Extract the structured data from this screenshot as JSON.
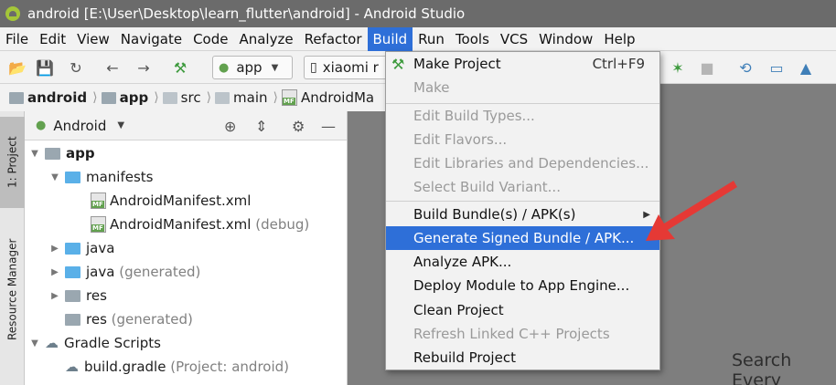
{
  "window": {
    "title": "android [E:\\User\\Desktop\\learn_flutter\\android] - Android Studio"
  },
  "menu": [
    "File",
    "Edit",
    "View",
    "Navigate",
    "Code",
    "Analyze",
    "Refactor",
    "Build",
    "Run",
    "Tools",
    "VCS",
    "Window",
    "Help"
  ],
  "menu_active": "Build",
  "toolbar": {
    "run_config": "app",
    "device": "xiaomi r"
  },
  "breadcrumb": [
    "android",
    "app",
    "src",
    "main",
    "AndroidMa"
  ],
  "sidestrip": {
    "project_tab": "1: Project",
    "resource_tab": "Resource Manager"
  },
  "project_panel": {
    "view_selector": "Android",
    "tree": [
      {
        "label": "app",
        "bold": true
      },
      {
        "label": "manifests"
      },
      {
        "label": "AndroidManifest.xml"
      },
      {
        "label": "AndroidManifest.xml",
        "suffix": "(debug)"
      },
      {
        "label": "java"
      },
      {
        "label": "java",
        "suffix": "(generated)"
      },
      {
        "label": "res"
      },
      {
        "label": "res",
        "suffix": "(generated)"
      },
      {
        "label": "Gradle Scripts"
      },
      {
        "label": "build.gradle",
        "suffix": "(Project: android)"
      }
    ]
  },
  "build_menu": {
    "items": [
      {
        "label": "Make Project",
        "shortcut": "Ctrl+F9",
        "enabled": true
      },
      {
        "label": "Make",
        "enabled": false
      },
      {
        "label": "Edit Build Types...",
        "enabled": false
      },
      {
        "label": "Edit Flavors...",
        "enabled": false
      },
      {
        "label": "Edit Libraries and Dependencies...",
        "enabled": false
      },
      {
        "label": "Select Build Variant...",
        "enabled": false
      },
      {
        "label": "Build Bundle(s) / APK(s)",
        "enabled": true,
        "submenu": true
      },
      {
        "label": "Generate Signed Bundle / APK...",
        "enabled": true,
        "highlighted": true
      },
      {
        "label": "Analyze APK...",
        "enabled": true
      },
      {
        "label": "Deploy Module to App Engine...",
        "enabled": true
      },
      {
        "label": "Clean Project",
        "enabled": true
      },
      {
        "label": "Refresh Linked C++ Projects",
        "enabled": false
      },
      {
        "label": "Rebuild Project",
        "enabled": true
      }
    ]
  },
  "editor": {
    "hint": "Search Every"
  },
  "colors": {
    "accent": "#2e6fd8",
    "annotation_arrow": "#e53935",
    "android_green": "#a4c639"
  }
}
